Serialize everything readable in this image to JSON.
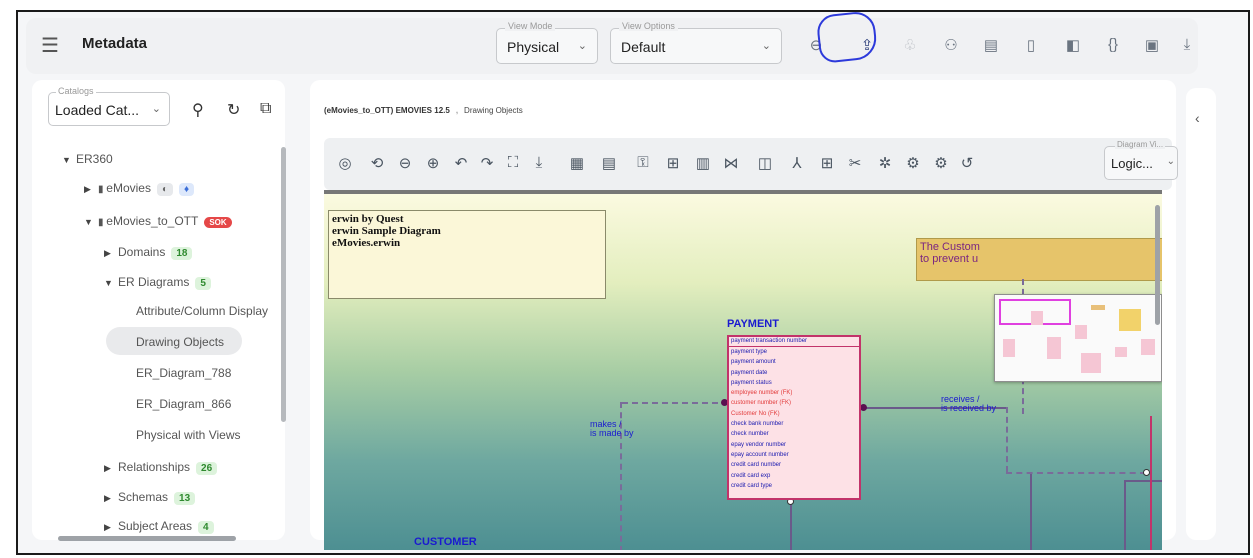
{
  "header": {
    "title": "Metadata",
    "view_mode": {
      "label": "View Mode",
      "value": "Physical"
    },
    "view_options": {
      "label": "View Options",
      "value": "Default"
    },
    "icons": [
      "link-icon",
      "share-icon",
      "hierarchy-icon",
      "people-icon",
      "comment-icon",
      "csv-icon",
      "compare-icon",
      "json-icon",
      "document-icon",
      "download-icon"
    ]
  },
  "sidebar": {
    "catalogs": {
      "label": "Catalogs",
      "value": "Loaded Cat..."
    },
    "tree": {
      "root": "ER360",
      "emovies": "eMovies",
      "emovies_ott": "eMovies_to_OTT",
      "emovies_ott_badge": "SOK",
      "domains": "Domains",
      "domains_count": "18",
      "er_diagrams": "ER Diagrams",
      "er_diagrams_count": "5",
      "attr_display": "Attribute/Column Display",
      "drawing_objects": "Drawing Objects",
      "er_788": "ER_Diagram_788",
      "er_866": "ER_Diagram_866",
      "physical_views": "Physical with Views",
      "relationships": "Relationships",
      "relationships_count": "26",
      "schemas": "Schemas",
      "schemas_count": "13",
      "subject_areas": "Subject Areas",
      "subject_areas_count": "4"
    }
  },
  "main": {
    "breadcrumb": {
      "model": "(eMovies_to_OTT) EMOVIES 12.5",
      "sep": ",",
      "current": "Drawing Objects"
    },
    "diagram_view": {
      "label": "Diagram Vi...",
      "value": "Logic..."
    }
  },
  "canvas": {
    "note_lines": [
      "erwin by Quest",
      "erwin Sample Diagram",
      "eMovies.erwin"
    ],
    "customer_note_lines": [
      "The Custom",
      "to prevent u"
    ],
    "payment": {
      "title": "PAYMENT",
      "pk": "payment transaction number",
      "attributes": [
        {
          "name": "payment type",
          "fk": false
        },
        {
          "name": "payment amount",
          "fk": false
        },
        {
          "name": "payment date",
          "fk": false
        },
        {
          "name": "payment status",
          "fk": false
        },
        {
          "name": "employee number (FK)",
          "fk": true
        },
        {
          "name": "customer number (FK)",
          "fk": true
        },
        {
          "name": "Customer No (FK)",
          "fk": true
        },
        {
          "name": "check bank number",
          "fk": false
        },
        {
          "name": "check number",
          "fk": false
        },
        {
          "name": "epay vendor number",
          "fk": false
        },
        {
          "name": "epay account number",
          "fk": false
        },
        {
          "name": "credit card number",
          "fk": false
        },
        {
          "name": "credit card exp",
          "fk": false
        },
        {
          "name": "credit card type",
          "fk": false
        }
      ]
    },
    "rel_makes": [
      "makes /",
      "is made by"
    ],
    "rel_receives": [
      "receives /",
      "is received by"
    ],
    "customer_title": "CUSTOMER"
  },
  "colors": {
    "accent_circle": "#2d3adb",
    "entity_border": "#c2336a",
    "fk_text": "#e23a3a"
  }
}
